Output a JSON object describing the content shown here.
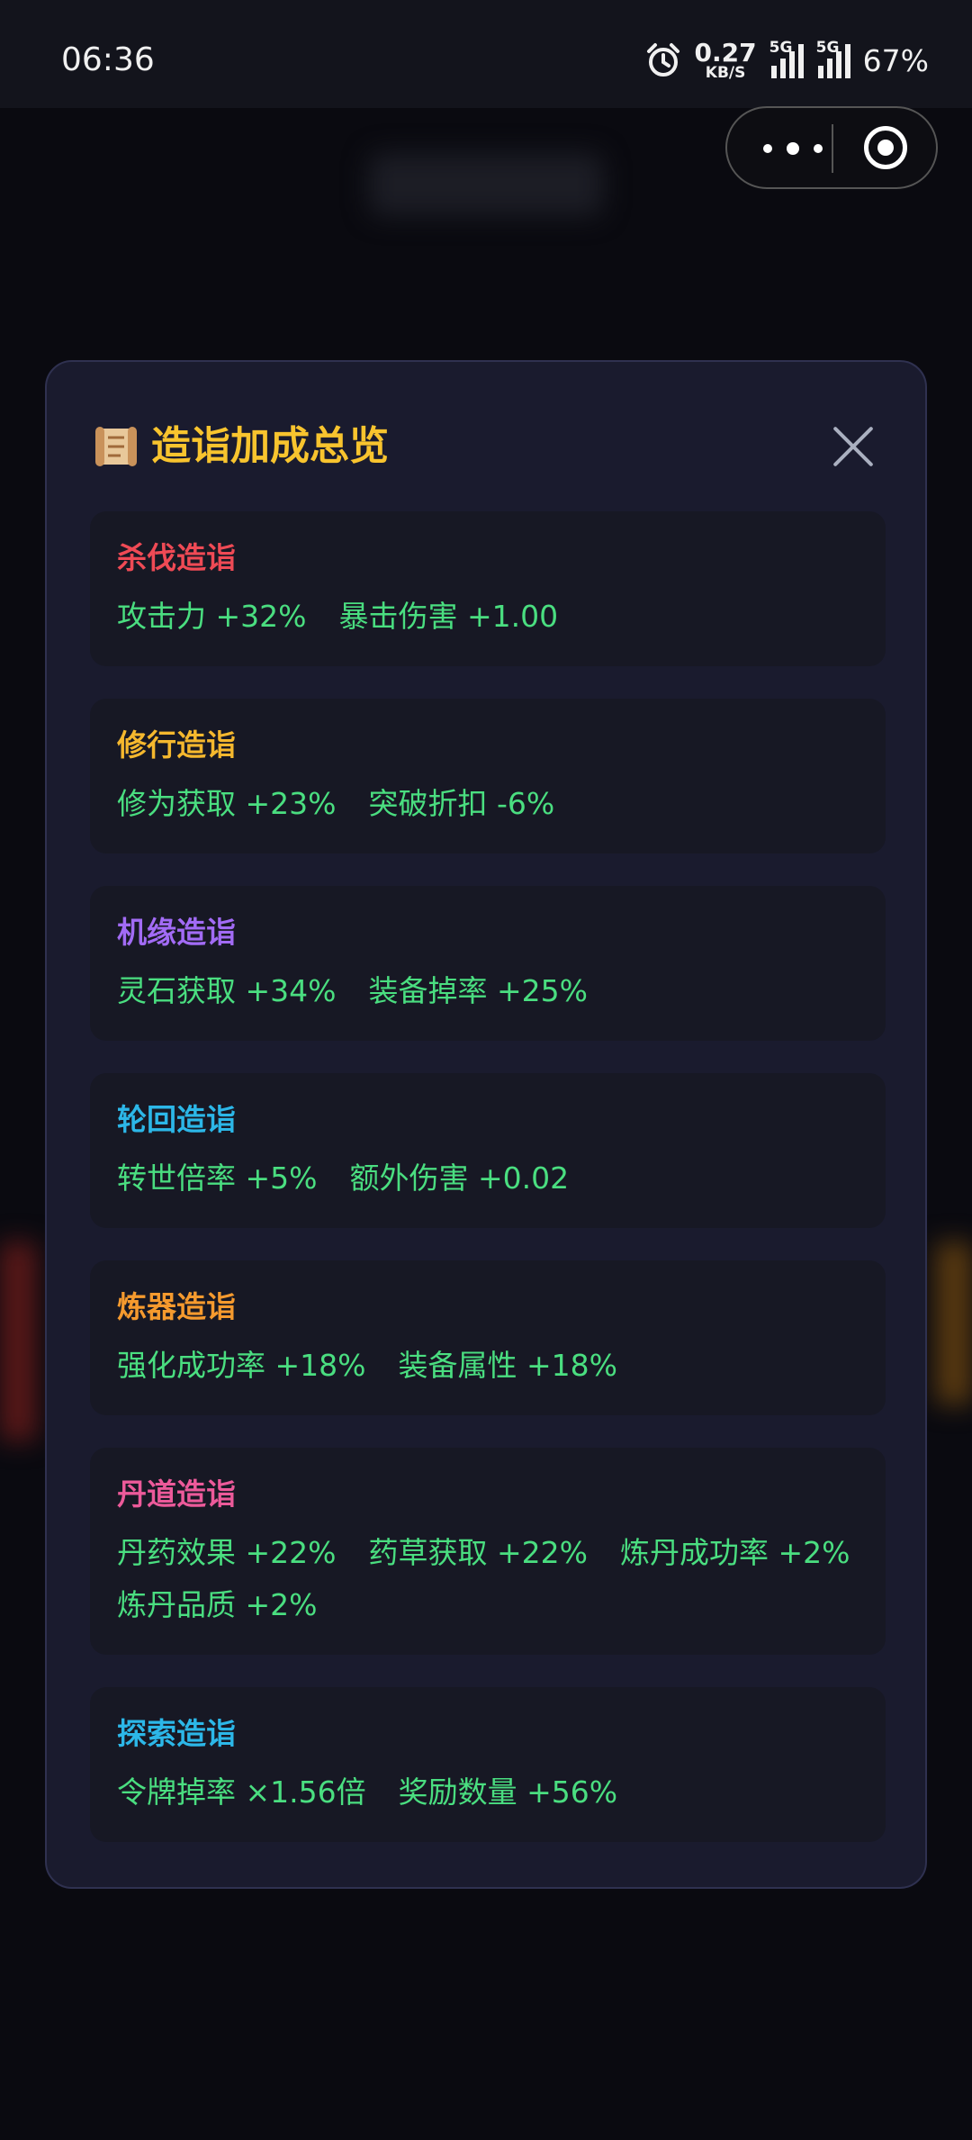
{
  "status_bar": {
    "time": "06:36",
    "net_speed": "0.27",
    "net_unit": "KB/S",
    "signal1": "5G",
    "signal2": "5G",
    "battery": "67%"
  },
  "modal": {
    "title": "造诣加成总览",
    "cards": [
      {
        "title": "杀伐造诣",
        "color": "#ef4a55",
        "bonuses": [
          "攻击力 +32%",
          "暴击伤害 +1.00"
        ]
      },
      {
        "title": "修行造诣",
        "color": "#f5b82e",
        "bonuses": [
          "修为获取 +23%",
          "突破折扣 -6%"
        ]
      },
      {
        "title": "机缘造诣",
        "color": "#a26bf5",
        "bonuses": [
          "灵石获取 +34%",
          "装备掉率 +25%"
        ]
      },
      {
        "title": "轮回造诣",
        "color": "#2cb7e8",
        "bonuses": [
          "转世倍率 +5%",
          "额外伤害 +0.02"
        ]
      },
      {
        "title": "炼器造诣",
        "color": "#f59a2e",
        "bonuses": [
          "强化成功率 +18%",
          "装备属性 +18%"
        ]
      },
      {
        "title": "丹道造诣",
        "color": "#ec5a9a",
        "bonuses": [
          "丹药效果 +22%",
          "药草获取 +22%",
          "炼丹成功率 +2%",
          "炼丹品质 +2%"
        ]
      },
      {
        "title": "探索造诣",
        "color": "#2cb7e8",
        "bonuses": [
          "令牌掉率 ×1.56倍",
          "奖励数量 +56%"
        ]
      }
    ]
  },
  "colors": {
    "bonus_text": "#4ade80",
    "title": "#f8c42e"
  },
  "icons": [
    "alarm-icon",
    "scroll-icon",
    "close-icon",
    "more-icon",
    "mini-program-close-icon"
  ]
}
